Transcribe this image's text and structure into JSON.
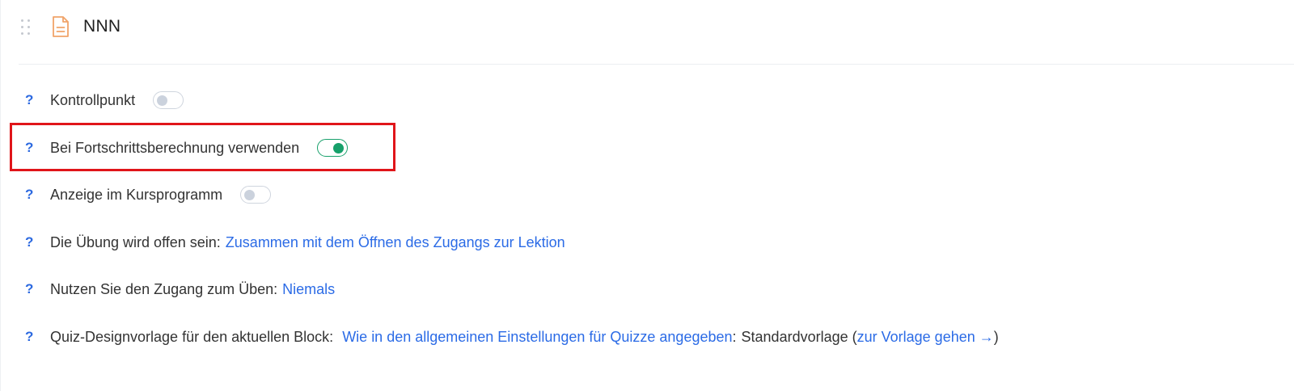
{
  "header": {
    "title": "NNN",
    "drag_icon": "drag-handle-icon",
    "doc_icon": "document-icon"
  },
  "settings": {
    "help_symbol": "?",
    "checkpoint": {
      "label": "Kontrollpunkt",
      "enabled": false
    },
    "progress": {
      "label": "Bei Fortschrittsberechnung verwenden",
      "enabled": true
    },
    "course_program": {
      "label": "Anzeige im Kursprogramm",
      "enabled": false
    },
    "open_exercise": {
      "label": "Die Übung wird offen sein:",
      "value": "Zusammen mit dem Öffnen des Zugangs zur Lektion"
    },
    "practice_access": {
      "label": "Nutzen Sie den Zugang zum Üben:",
      "value": "Niemals"
    },
    "quiz_template": {
      "label": "Quiz-Designvorlage für den aktuellen Block:",
      "value_link": "Wie in den allgemeinen Einstellungen für Quizze angegeben",
      "colon": ":",
      "template_name": "Standardvorlage",
      "paren_open": "(",
      "goto_link": "zur Vorlage gehen →",
      "paren_close": ")"
    }
  },
  "colors": {
    "accent_link": "#2b6be6",
    "toggle_on": "#16a06a",
    "highlight": "#e0151a",
    "doc_icon": "#f0a46a"
  }
}
